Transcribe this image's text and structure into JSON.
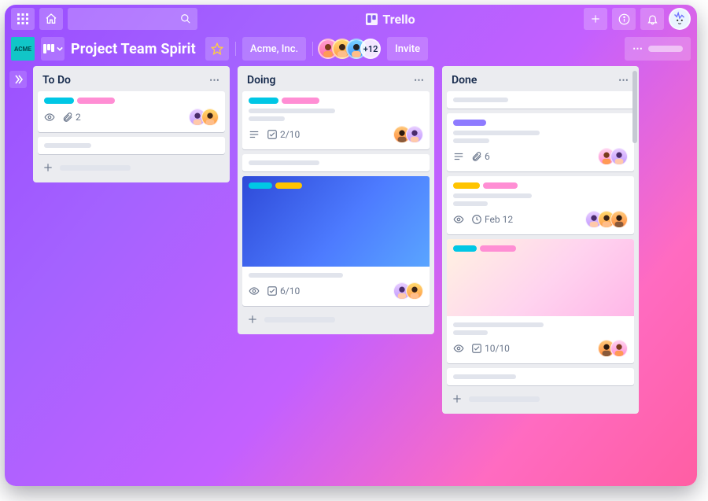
{
  "brand": "Trello",
  "board": {
    "title": "Project Team Spirit",
    "org": "Acme, Inc.",
    "extraMembersLabel": "+12",
    "inviteLabel": "Invite"
  },
  "colors": {
    "teal": "#00c7e5",
    "pink": "#ff8ed4",
    "yellow": "#ffc400",
    "purple": "#8e7bff"
  },
  "lists": {
    "todo": {
      "title": "To Do",
      "cards": [
        {
          "eye": true,
          "attachments": "2"
        },
        {
          "placeholder": true
        }
      ]
    },
    "doing": {
      "title": "Doing",
      "cards": [
        {
          "checklist": "2/10",
          "description": true
        },
        {
          "placeholder": true
        },
        {
          "cover": true,
          "eye": true,
          "checklist": "6/10"
        }
      ]
    },
    "done": {
      "title": "Done",
      "cards": [
        {
          "placeholder": true
        },
        {
          "description": true,
          "attachments": "6"
        },
        {
          "eye": true,
          "date": "Feb 12"
        },
        {
          "pinkcover": true,
          "eye": true,
          "checklist": "10/10"
        },
        {
          "placeholder": true
        }
      ]
    }
  }
}
